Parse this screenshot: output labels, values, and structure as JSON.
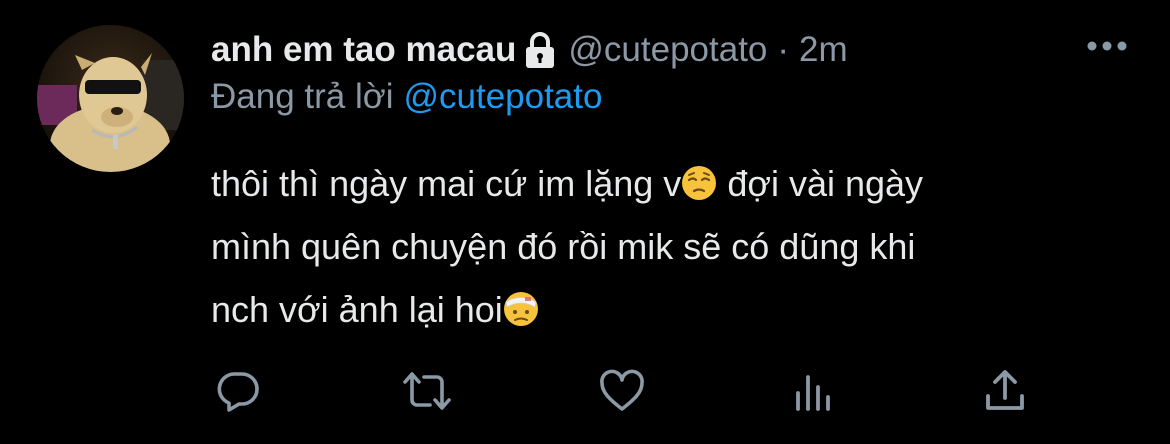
{
  "tweet": {
    "display_name": "anh em tao macau",
    "handle": "@cutepotato",
    "separator": "·",
    "time": "2m",
    "reply_prefix": "Đang trả lời",
    "reply_handle": "@cutepotato",
    "body_lines": [
      {
        "text_before": "thôi thì ngày mai cứ im lặng v",
        "emoji": "pensive-face",
        "text_after": " đợi vài ngày"
      },
      {
        "text_before": "mình quên chuyện đó rồi mik sẽ có dũng khi",
        "emoji": "",
        "text_after": ""
      },
      {
        "text_before": "nch với ảnh lại hoi",
        "emoji": "head-bandage-face",
        "text_after": ""
      }
    ]
  },
  "icons": {
    "lock": "lock-icon",
    "more": "more-icon",
    "reply": "reply-icon",
    "retweet": "retweet-icon",
    "like": "heart-icon",
    "analytics": "analytics-icon",
    "share": "share-icon"
  },
  "colors": {
    "background": "#000000",
    "text": "#e7e9ea",
    "secondary": "#8b98a5",
    "accent": "#1d9bf0"
  }
}
